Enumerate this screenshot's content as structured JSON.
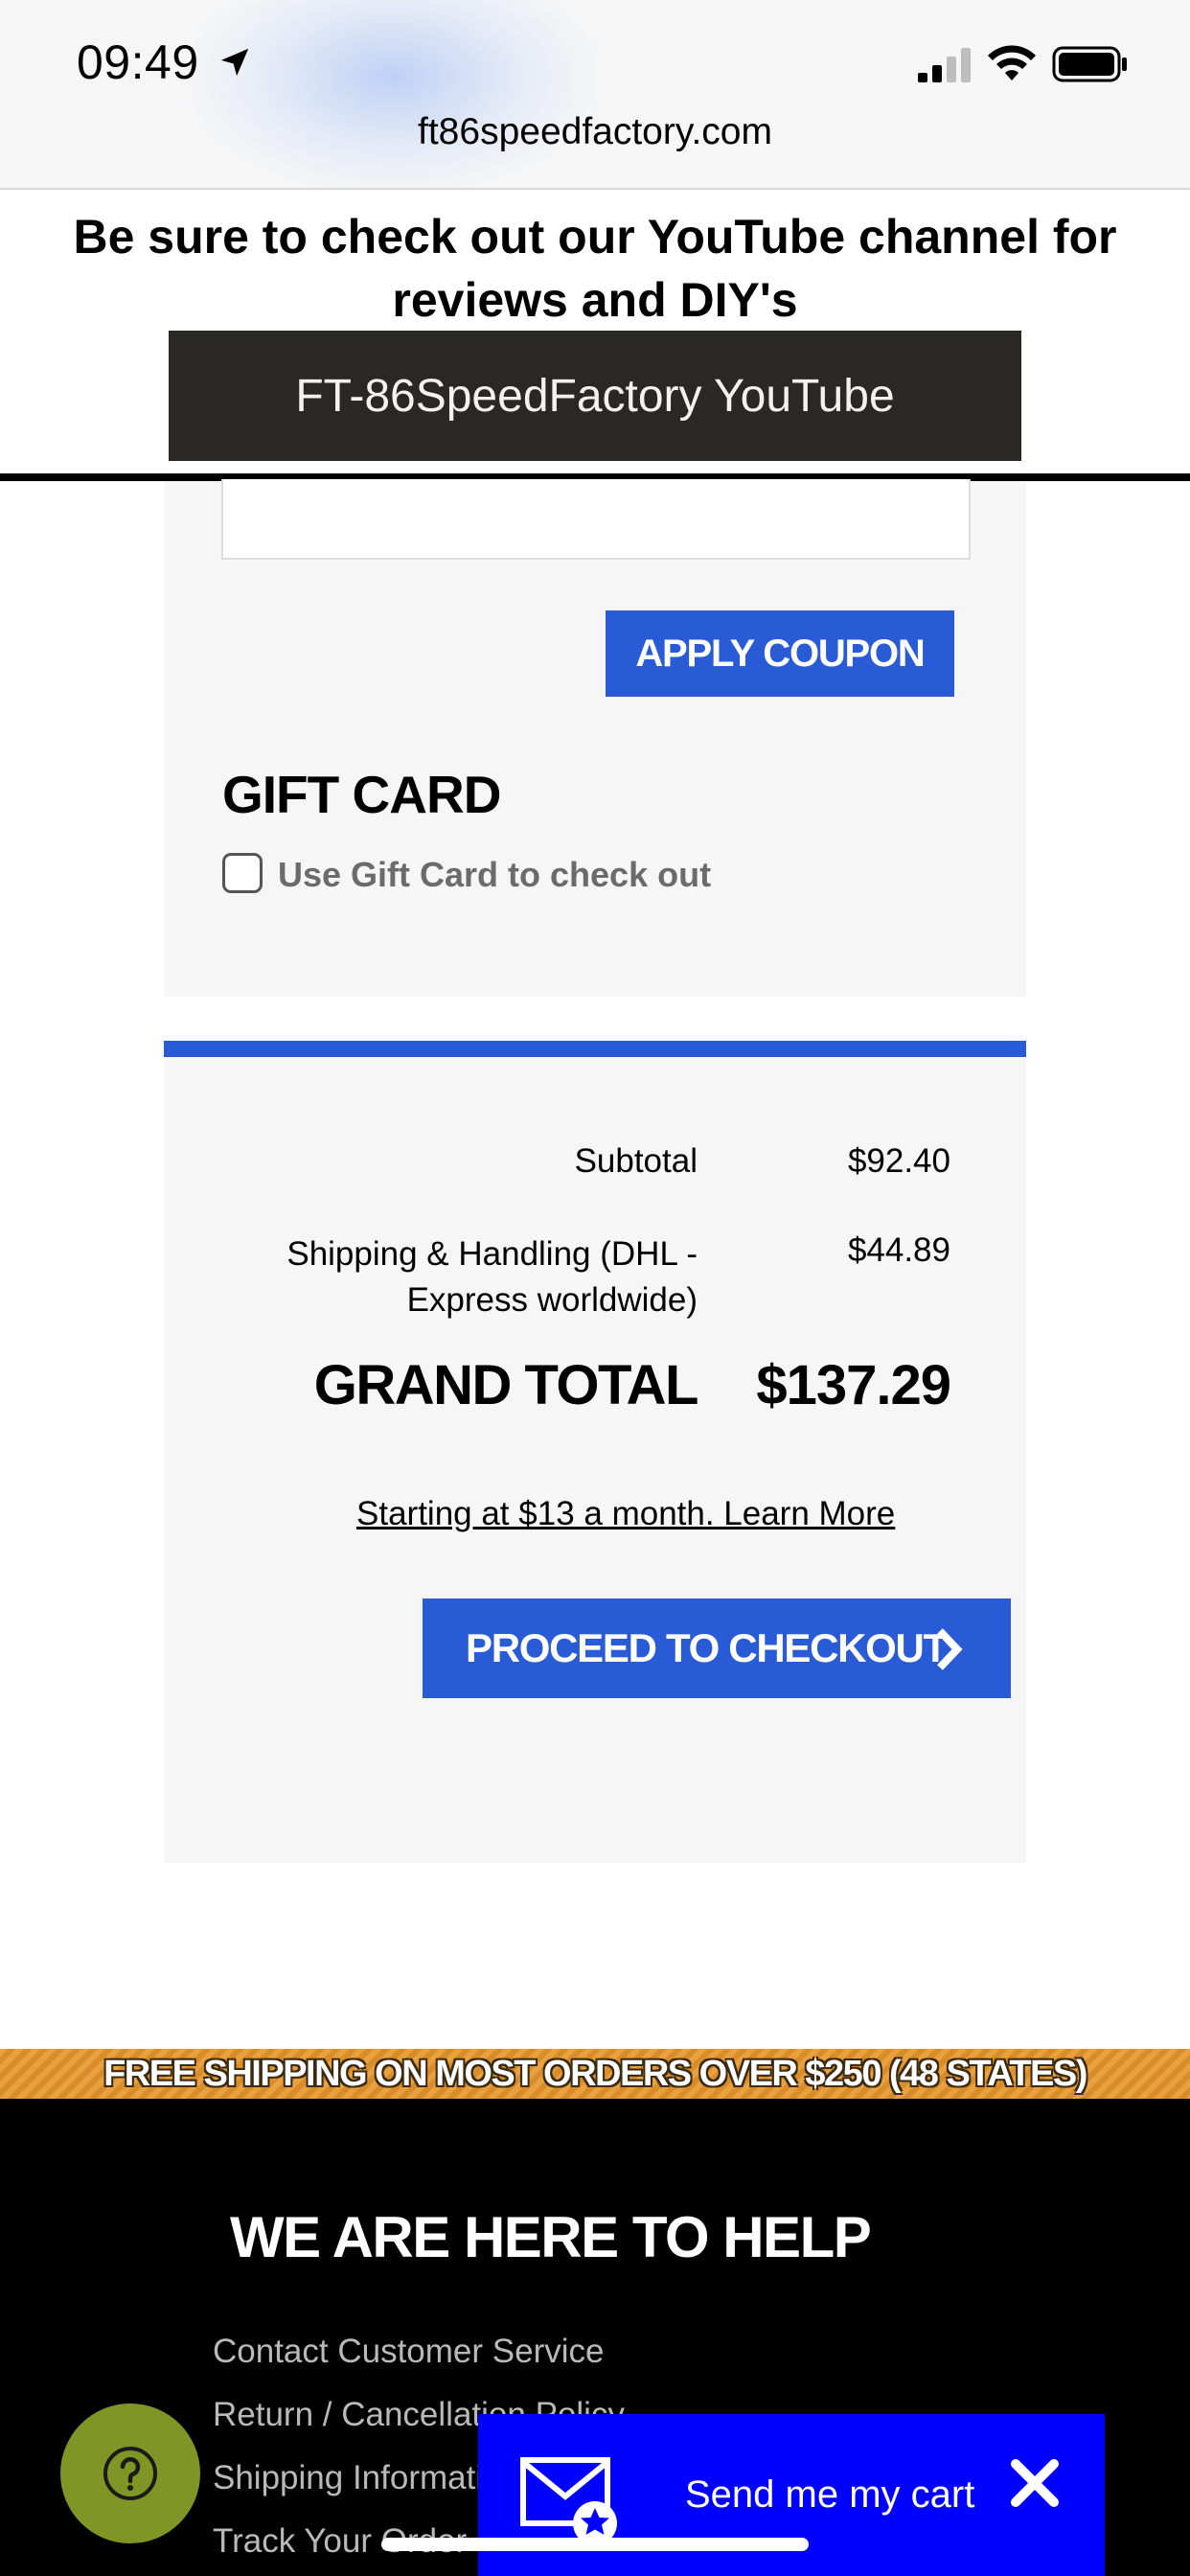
{
  "status_bar": {
    "time": "09:49",
    "url": "ft86speedfactory.com"
  },
  "banner": {
    "text": "Be sure to check out our YouTube channel for reviews and DIY's",
    "button_label": "FT-86SpeedFactory YouTube"
  },
  "coupon": {
    "input_value": "",
    "apply_label": "APPLY COUPON"
  },
  "gift_card": {
    "title": "GIFT CARD",
    "checkbox_label": "Use Gift Card to check out",
    "checked": false
  },
  "totals": {
    "subtotal_label": "Subtotal",
    "subtotal_value": "$92.40",
    "shipping_label": "Shipping & Handling (DHL - Express worldwide)",
    "shipping_value": "$44.89",
    "grand_total_label": "GRAND TOTAL",
    "grand_total_value": "$137.29",
    "financing_link": "Starting at $13 a month. Learn More",
    "checkout_label": "PROCEED TO CHECKOUT"
  },
  "promo_strip": "FREE SHIPPING ON MOST ORDERS OVER $250 (48 STATES)",
  "footer": {
    "title": "WE ARE HERE TO HELP",
    "links": [
      "Contact Customer Service",
      "Return / Cancellation Policy",
      "Shipping Information",
      "Track Your Order"
    ]
  },
  "send_cart": {
    "label": "Send me my cart"
  },
  "colors": {
    "accent_blue": "#2a5bd7",
    "send_cart_blue": "#0000ff",
    "help_green": "#7f9526",
    "promo_orange": "#e9a13f"
  },
  "icons": [
    "location-arrow-icon",
    "signal-icon",
    "wifi-icon",
    "battery-icon",
    "chevron-right-icon",
    "question-icon",
    "mail-star-icon",
    "close-icon"
  ]
}
